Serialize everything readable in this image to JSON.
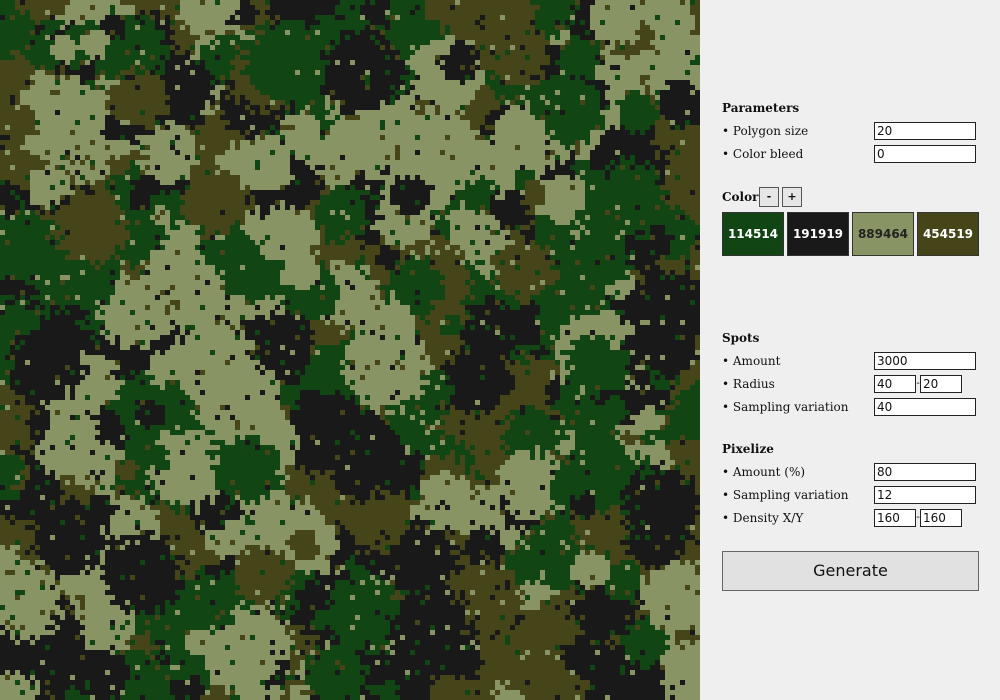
{
  "preview": {
    "icon": "generated-camouflage-pattern"
  },
  "parameters": {
    "title": "Parameters",
    "polygon_size": {
      "label": "• Polygon size",
      "value": "20"
    },
    "color_bleed": {
      "label": "• Color bleed",
      "value": "0"
    }
  },
  "colors": {
    "title": "Colors",
    "minus_label": "-",
    "plus_label": "+",
    "swatches": [
      {
        "hex": "#114514",
        "label": "114514",
        "text_color": "#ffffff"
      },
      {
        "hex": "#191919",
        "label": "191919",
        "text_color": "#ffffff"
      },
      {
        "hex": "#889464",
        "label": "889464",
        "text_color": "#222222"
      },
      {
        "hex": "#454519",
        "label": "454519",
        "text_color": "#ffffff"
      }
    ]
  },
  "spots": {
    "title": "Spots",
    "amount": {
      "label": "• Amount",
      "value": "3000"
    },
    "radius": {
      "label": "• Radius",
      "min": "40",
      "max": "20"
    },
    "sampling_variation": {
      "label": "• Sampling variation",
      "value": "40"
    }
  },
  "pixelize": {
    "title": "Pixelize",
    "amount": {
      "label": "• Amount (%)",
      "value": "80"
    },
    "sampling_variation": {
      "label": "• Sampling variation",
      "value": "12"
    },
    "density": {
      "label": "• Density X/Y",
      "x": "160",
      "y": "160"
    }
  },
  "generate_label": "Generate"
}
